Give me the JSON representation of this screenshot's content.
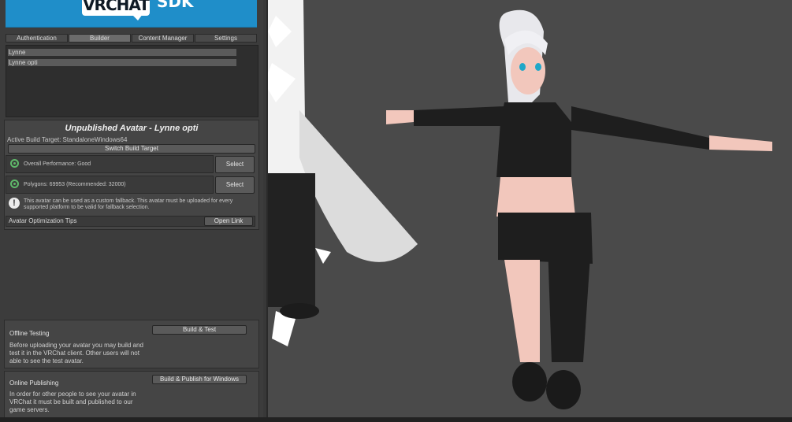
{
  "banner": {
    "logo": "VRCHAT",
    "sdk": "SDK"
  },
  "tabs": [
    {
      "label": "Authentication"
    },
    {
      "label": "Builder"
    },
    {
      "label": "Content Manager"
    },
    {
      "label": "Settings"
    }
  ],
  "avatars": [
    {
      "name": "Lynne"
    },
    {
      "name": "Lynne opti"
    }
  ],
  "builder": {
    "title": "Unpublished Avatar - Lynne  opti",
    "active_target": "Active Build Target: StandaloneWindows64",
    "switch_button": "Switch Build Target",
    "checks": [
      {
        "text": "Overall Performance: Good",
        "button": "Select"
      },
      {
        "text": "Polygons: 69953 (Recommended: 32000)",
        "button": "Select"
      }
    ],
    "fallback_notice": "This avatar can be used as a custom fallback. This avatar must be uploaded for every supported platform to be valid for fallback selection.",
    "tips_label": "Avatar Optimization Tips",
    "tips_button": "Open Link"
  },
  "offline": {
    "heading": "Offline Testing",
    "button": "Build & Test",
    "text": "Before uploading your avatar you may build and test it in the VRChat client. Other users will not able to see the test avatar."
  },
  "online": {
    "heading": "Online Publishing",
    "button": "Build & Publish for Windows",
    "text": "In order for other people to see your avatar in VRChat it must be built and published to our game servers."
  },
  "colors": {
    "banner": "#1f8ec9",
    "good_status": "#5fb96a",
    "panel_bg": "#3c3c3c",
    "viewport_bg": "#4a4a4a"
  }
}
